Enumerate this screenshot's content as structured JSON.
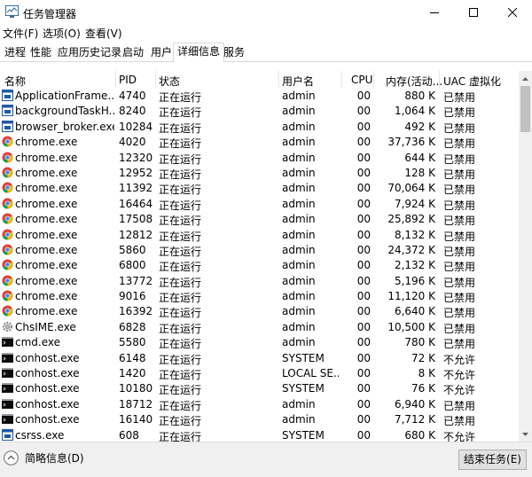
{
  "window": {
    "title": "任务管理器"
  },
  "menu": [
    "文件(F)",
    "选项(O)",
    "查看(V)"
  ],
  "tabs": [
    "进程",
    "性能",
    "应用历史记录",
    "启动",
    "用户",
    "详细信息",
    "服务"
  ],
  "active_tab": "详细信息",
  "columns": {
    "name": "名称",
    "pid": "PID",
    "status": "状态",
    "user": "用户名",
    "cpu": "CPU",
    "mem": "内存(活动...",
    "uac": "UAC 虚拟化"
  },
  "rows": [
    {
      "name": "ApplicationFrame...",
      "pid": "4740",
      "status": "正在运行",
      "user": "admin",
      "cpu": "00",
      "mem": "880 K",
      "uac": "已禁用",
      "icon": "app-window-icon"
    },
    {
      "name": "backgroundTaskH...",
      "pid": "8240",
      "status": "正在运行",
      "user": "admin",
      "cpu": "00",
      "mem": "1,064 K",
      "uac": "已禁用",
      "icon": "app-window-icon"
    },
    {
      "name": "browser_broker.exe",
      "pid": "10284",
      "status": "正在运行",
      "user": "admin",
      "cpu": "00",
      "mem": "492 K",
      "uac": "已禁用",
      "icon": "app-window-icon"
    },
    {
      "name": "chrome.exe",
      "pid": "4020",
      "status": "正在运行",
      "user": "admin",
      "cpu": "00",
      "mem": "37,736 K",
      "uac": "已禁用",
      "icon": "chrome-icon"
    },
    {
      "name": "chrome.exe",
      "pid": "12320",
      "status": "正在运行",
      "user": "admin",
      "cpu": "00",
      "mem": "644 K",
      "uac": "已禁用",
      "icon": "chrome-icon"
    },
    {
      "name": "chrome.exe",
      "pid": "12952",
      "status": "正在运行",
      "user": "admin",
      "cpu": "00",
      "mem": "128 K",
      "uac": "已禁用",
      "icon": "chrome-icon"
    },
    {
      "name": "chrome.exe",
      "pid": "11392",
      "status": "正在运行",
      "user": "admin",
      "cpu": "00",
      "mem": "70,064 K",
      "uac": "已禁用",
      "icon": "chrome-icon"
    },
    {
      "name": "chrome.exe",
      "pid": "16464",
      "status": "正在运行",
      "user": "admin",
      "cpu": "00",
      "mem": "7,924 K",
      "uac": "已禁用",
      "icon": "chrome-icon"
    },
    {
      "name": "chrome.exe",
      "pid": "17508",
      "status": "正在运行",
      "user": "admin",
      "cpu": "00",
      "mem": "25,892 K",
      "uac": "已禁用",
      "icon": "chrome-icon"
    },
    {
      "name": "chrome.exe",
      "pid": "12812",
      "status": "正在运行",
      "user": "admin",
      "cpu": "00",
      "mem": "8,132 K",
      "uac": "已禁用",
      "icon": "chrome-icon"
    },
    {
      "name": "chrome.exe",
      "pid": "5860",
      "status": "正在运行",
      "user": "admin",
      "cpu": "00",
      "mem": "24,372 K",
      "uac": "已禁用",
      "icon": "chrome-icon"
    },
    {
      "name": "chrome.exe",
      "pid": "6800",
      "status": "正在运行",
      "user": "admin",
      "cpu": "00",
      "mem": "2,132 K",
      "uac": "已禁用",
      "icon": "chrome-icon"
    },
    {
      "name": "chrome.exe",
      "pid": "13772",
      "status": "正在运行",
      "user": "admin",
      "cpu": "00",
      "mem": "5,196 K",
      "uac": "已禁用",
      "icon": "chrome-icon"
    },
    {
      "name": "chrome.exe",
      "pid": "9016",
      "status": "正在运行",
      "user": "admin",
      "cpu": "00",
      "mem": "11,120 K",
      "uac": "已禁用",
      "icon": "chrome-icon"
    },
    {
      "name": "chrome.exe",
      "pid": "16392",
      "status": "正在运行",
      "user": "admin",
      "cpu": "00",
      "mem": "6,640 K",
      "uac": "已禁用",
      "icon": "chrome-icon"
    },
    {
      "name": "ChsIME.exe",
      "pid": "6828",
      "status": "正在运行",
      "user": "admin",
      "cpu": "00",
      "mem": "10,500 K",
      "uac": "已禁用",
      "icon": "ime-gear-icon"
    },
    {
      "name": "cmd.exe",
      "pid": "5580",
      "status": "正在运行",
      "user": "admin",
      "cpu": "00",
      "mem": "780 K",
      "uac": "已禁用",
      "icon": "console-icon"
    },
    {
      "name": "conhost.exe",
      "pid": "6148",
      "status": "正在运行",
      "user": "SYSTEM",
      "cpu": "00",
      "mem": "72 K",
      "uac": "不允许",
      "icon": "console-icon"
    },
    {
      "name": "conhost.exe",
      "pid": "1420",
      "status": "正在运行",
      "user": "LOCAL SE...",
      "cpu": "00",
      "mem": "8 K",
      "uac": "不允许",
      "icon": "console-icon"
    },
    {
      "name": "conhost.exe",
      "pid": "10180",
      "status": "正在运行",
      "user": "SYSTEM",
      "cpu": "00",
      "mem": "76 K",
      "uac": "不允许",
      "icon": "console-icon"
    },
    {
      "name": "conhost.exe",
      "pid": "18712",
      "status": "正在运行",
      "user": "admin",
      "cpu": "00",
      "mem": "6,940 K",
      "uac": "已禁用",
      "icon": "console-icon"
    },
    {
      "name": "conhost.exe",
      "pid": "16140",
      "status": "正在运行",
      "user": "admin",
      "cpu": "00",
      "mem": "7,712 K",
      "uac": "已禁用",
      "icon": "console-icon"
    },
    {
      "name": "csrss.exe",
      "pid": "608",
      "status": "正在运行",
      "user": "SYSTEM",
      "cpu": "00",
      "mem": "680 K",
      "uac": "不允许",
      "icon": "app-window-icon"
    }
  ],
  "footer": {
    "fewer_details": "简略信息(D)",
    "end_task": "结束任务(E)"
  },
  "colors": {
    "chrome_red": "#db4437",
    "chrome_yellow": "#f4b400",
    "chrome_green": "#0f9d58",
    "chrome_blue": "#4285f4",
    "app_blue": "#1e5aa8"
  }
}
